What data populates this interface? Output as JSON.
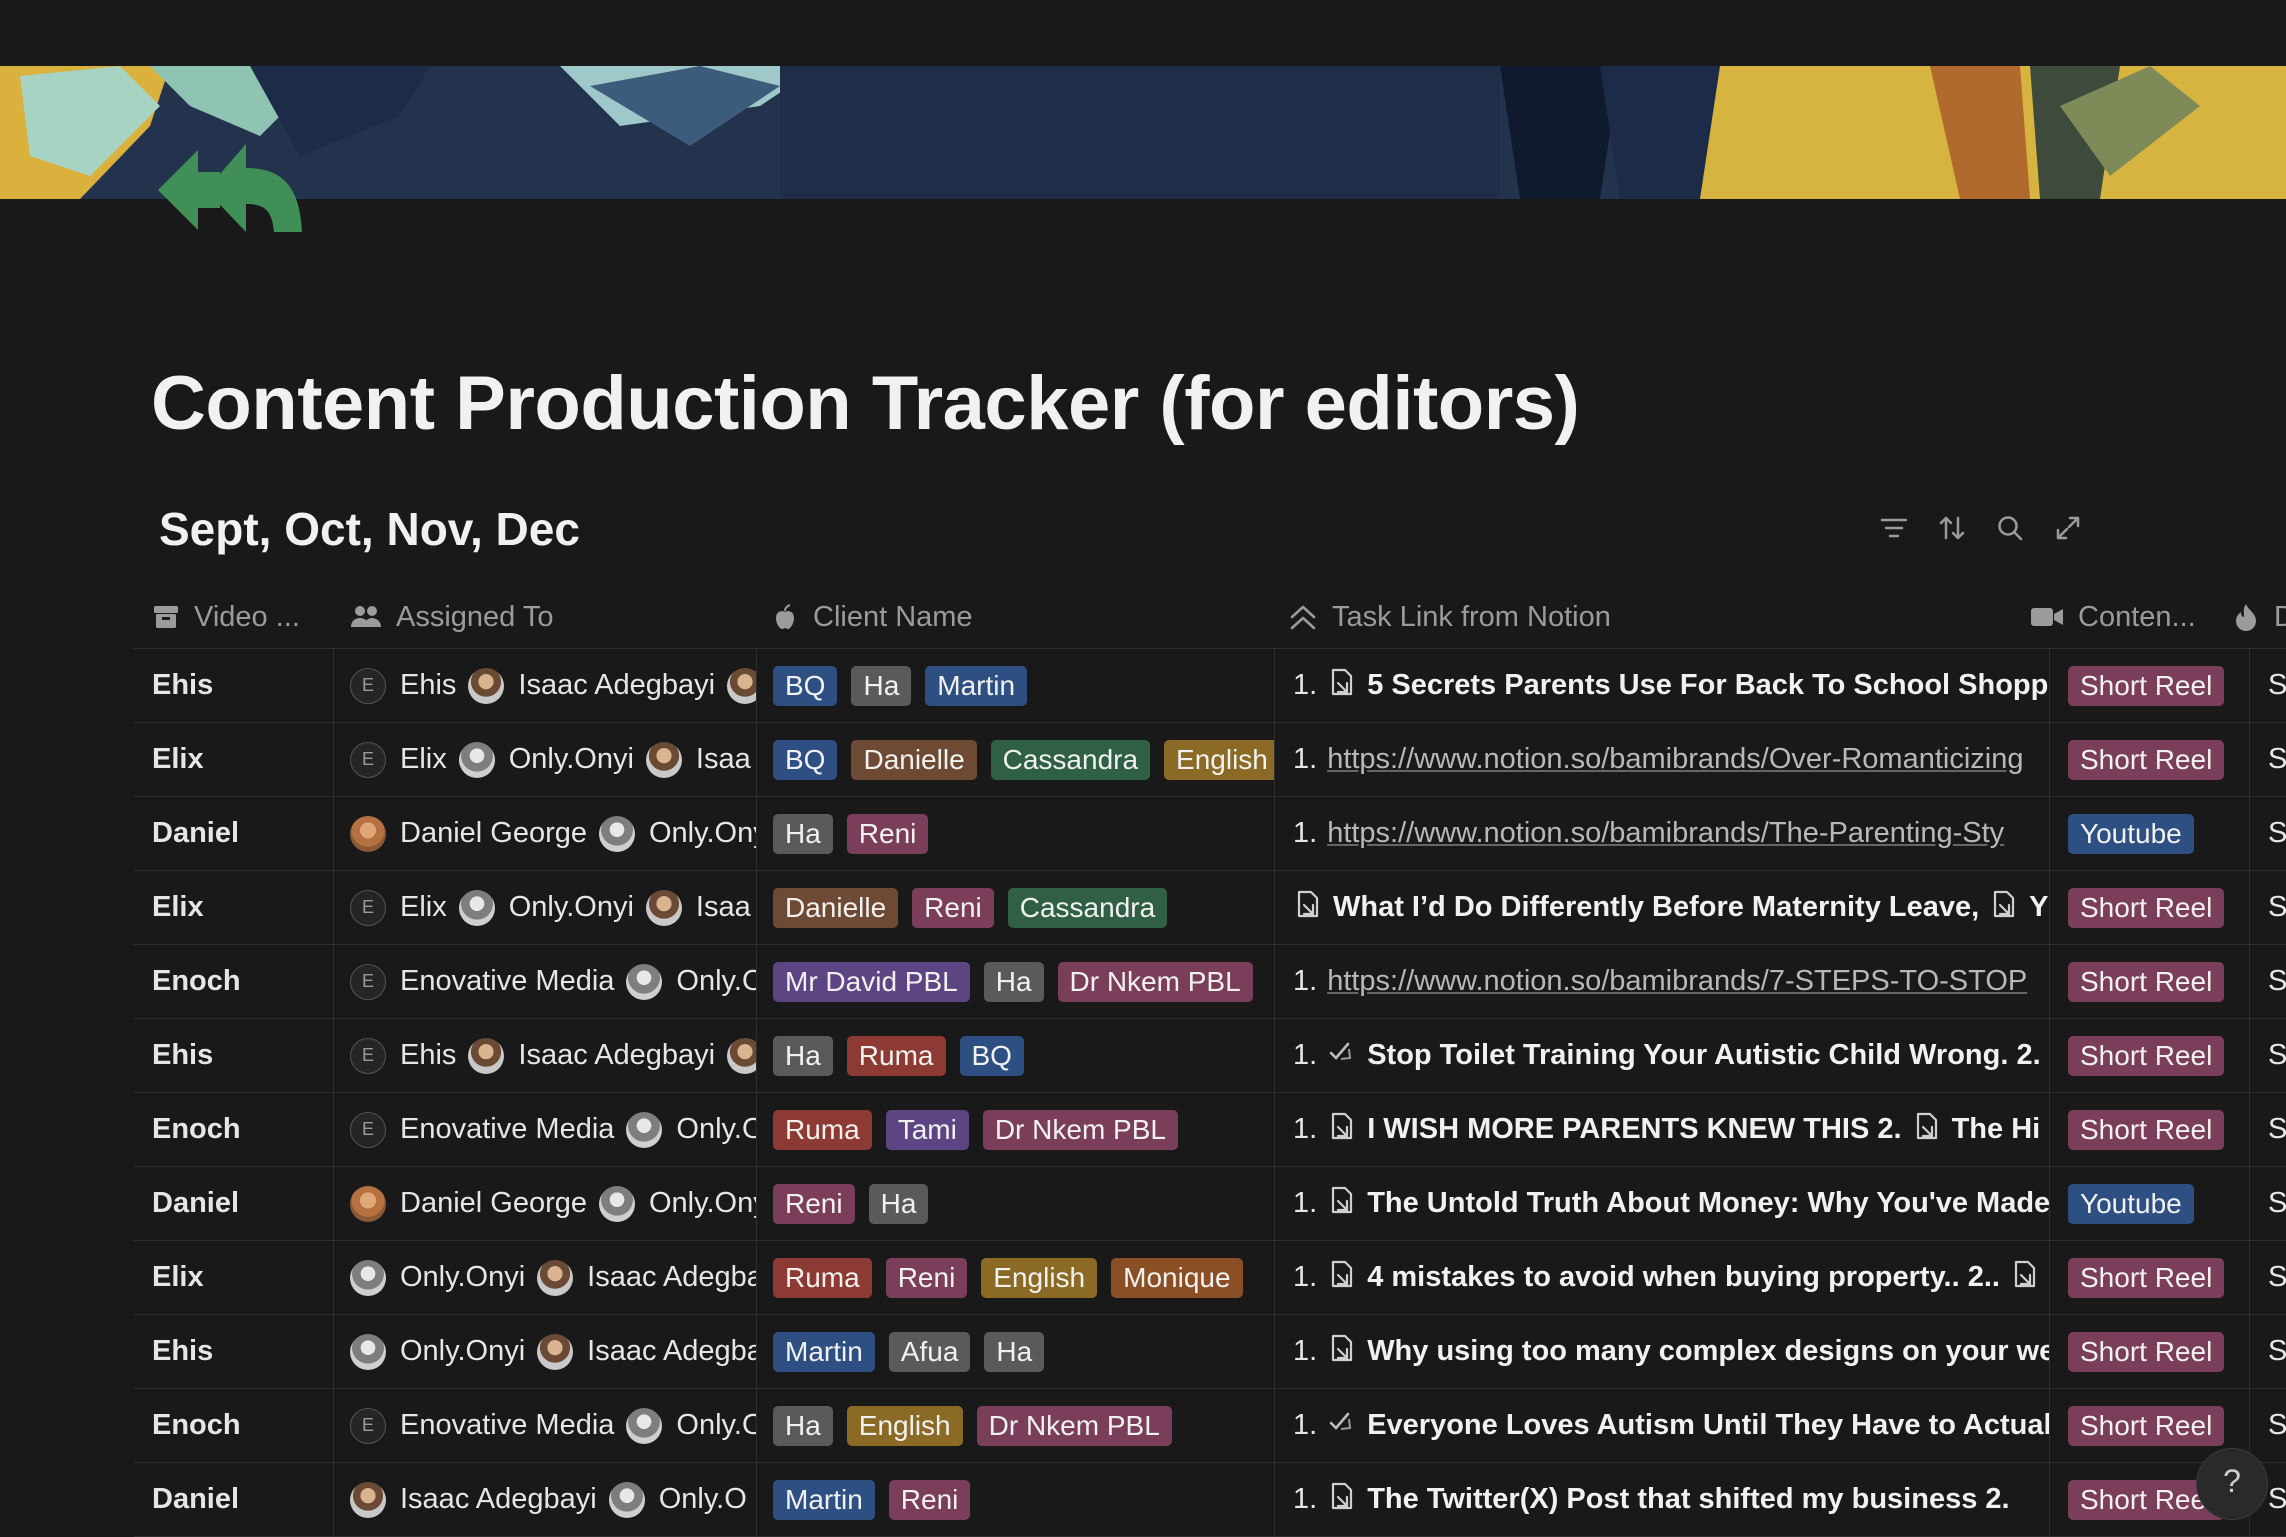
{
  "page": {
    "title": "Content Production Tracker (for editors)",
    "view_title": "Sept, Oct, Nov, Dec",
    "help_label": "?"
  },
  "icons": {
    "page_icon": "reply-all-arrows-icon",
    "filter": "filter-icon",
    "sort": "sort-icon",
    "search": "search-icon",
    "expand": "expand-icon"
  },
  "colors": {
    "background": "#191919",
    "page_icon": "#3f8f57"
  },
  "columns": {
    "video": "Video ...",
    "assigned": "Assigned To",
    "client": "Client Name",
    "task": "Task Link from Notion",
    "content": "Conten...",
    "date": "D"
  },
  "rows": [
    {
      "video": "Ehis",
      "assigned": [
        {
          "name": "Ehis",
          "avatar": "E"
        },
        {
          "name": "Isaac Adegbayi",
          "avatar": "photo"
        },
        {
          "name": "",
          "avatar": "photo"
        }
      ],
      "clients": [
        {
          "label": "BQ",
          "color": "blue"
        },
        {
          "label": "Ha",
          "color": "gray"
        },
        {
          "label": "Martin",
          "color": "blue"
        }
      ],
      "task": {
        "prefix": "1.",
        "text": "5 Secrets Parents Use For Back To School Shopp",
        "kind": "doc"
      },
      "content": "Short Reel",
      "content_color": "pink",
      "date": "Sept"
    },
    {
      "video": "Elix",
      "assigned": [
        {
          "name": "Elix",
          "avatar": "E"
        },
        {
          "name": "Only.Onyi",
          "avatar": "photo2"
        },
        {
          "name": "Isaa",
          "avatar": "photo"
        }
      ],
      "clients": [
        {
          "label": "BQ",
          "color": "blue"
        },
        {
          "label": "Danielle",
          "color": "brown"
        },
        {
          "label": "Cassandra",
          "color": "green"
        },
        {
          "label": "English",
          "color": "yellow"
        }
      ],
      "task": {
        "prefix": "1.",
        "text": "https://www.notion.so/bamibrands/Over-Romanticizing",
        "kind": "link"
      },
      "content": "Short Reel",
      "content_color": "pink",
      "date": "Sept"
    },
    {
      "video": "Daniel",
      "assigned": [
        {
          "name": "Daniel George",
          "avatar": "photo3"
        },
        {
          "name": "Only.Onyi",
          "avatar": "photo2"
        }
      ],
      "clients": [
        {
          "label": "Ha",
          "color": "gray"
        },
        {
          "label": "Reni",
          "color": "pink"
        }
      ],
      "task": {
        "prefix": "1.",
        "text": "https://www.notion.so/bamibrands/The-Parenting-Sty",
        "kind": "link"
      },
      "content": "Youtube",
      "content_color": "blue",
      "date": "Sept"
    },
    {
      "video": "Elix",
      "assigned": [
        {
          "name": "Elix",
          "avatar": "E"
        },
        {
          "name": "Only.Onyi",
          "avatar": "photo2"
        },
        {
          "name": "Isaa",
          "avatar": "photo"
        }
      ],
      "clients": [
        {
          "label": "Danielle",
          "color": "brown"
        },
        {
          "label": "Reni",
          "color": "pink"
        },
        {
          "label": "Cassandra",
          "color": "green"
        }
      ],
      "task": {
        "prefix": "",
        "text": "What I’d Do Differently Before Maternity Leave,",
        "kind": "doc",
        "trail": "Y"
      },
      "content": "Short Reel",
      "content_color": "pink",
      "date": "Sept"
    },
    {
      "video": "Enoch",
      "assigned": [
        {
          "name": "Enovative Media",
          "avatar": "E"
        },
        {
          "name": "Only.O",
          "avatar": "photo2"
        }
      ],
      "clients": [
        {
          "label": "Mr David PBL",
          "color": "purple"
        },
        {
          "label": "Ha",
          "color": "gray"
        },
        {
          "label": "Dr Nkem PBL",
          "color": "pink"
        }
      ],
      "task": {
        "prefix": "1.",
        "text": "https://www.notion.so/bamibrands/7-STEPS-TO-STOP",
        "kind": "link"
      },
      "content": "Short Reel",
      "content_color": "pink",
      "date": "Sept"
    },
    {
      "video": "Ehis",
      "assigned": [
        {
          "name": "Ehis",
          "avatar": "E"
        },
        {
          "name": "Isaac Adegbayi",
          "avatar": "photo"
        },
        {
          "name": "",
          "avatar": "photo"
        }
      ],
      "clients": [
        {
          "label": "Ha",
          "color": "gray"
        },
        {
          "label": "Ruma",
          "color": "red"
        },
        {
          "label": "BQ",
          "color": "blue"
        }
      ],
      "task": {
        "prefix": "1.",
        "text": "Stop Toilet Training Your Autistic Child Wrong. 2.",
        "kind": "check"
      },
      "content": "Short Reel",
      "content_color": "pink",
      "date": "Sept"
    },
    {
      "video": "Enoch",
      "assigned": [
        {
          "name": "Enovative Media",
          "avatar": "E"
        },
        {
          "name": "Only.O",
          "avatar": "photo2"
        }
      ],
      "clients": [
        {
          "label": "Ruma",
          "color": "red"
        },
        {
          "label": "Tami",
          "color": "purple"
        },
        {
          "label": "Dr Nkem PBL",
          "color": "pink"
        }
      ],
      "task": {
        "prefix": "1.",
        "text": "I WISH MORE PARENTS KNEW THIS 2.",
        "kind": "doc",
        "trail": "The Hi"
      },
      "content": "Short Reel",
      "content_color": "pink",
      "date": "Sept"
    },
    {
      "video": "Daniel",
      "assigned": [
        {
          "name": "Daniel George",
          "avatar": "photo3"
        },
        {
          "name": "Only.Onyi",
          "avatar": "photo2"
        }
      ],
      "clients": [
        {
          "label": "Reni",
          "color": "pink"
        },
        {
          "label": "Ha",
          "color": "gray"
        }
      ],
      "task": {
        "prefix": "1.",
        "text": "The Untold Truth About Money: Why You've Made",
        "kind": "doc"
      },
      "content": "Youtube",
      "content_color": "blue",
      "date": "Sept"
    },
    {
      "video": "Elix",
      "assigned": [
        {
          "name": "Only.Onyi",
          "avatar": "photo2"
        },
        {
          "name": "Isaac Adegba",
          "avatar": "photo"
        }
      ],
      "clients": [
        {
          "label": "Ruma",
          "color": "red"
        },
        {
          "label": "Reni",
          "color": "pink"
        },
        {
          "label": "English",
          "color": "yellow"
        },
        {
          "label": "Monique",
          "color": "orange"
        }
      ],
      "task": {
        "prefix": "1.",
        "text": "4 mistakes to avoid when buying property.. 2..",
        "kind": "doc",
        "trail": ""
      },
      "content": "Short Reel",
      "content_color": "pink",
      "date": "Sept"
    },
    {
      "video": "Ehis",
      "assigned": [
        {
          "name": "Only.Onyi",
          "avatar": "photo2"
        },
        {
          "name": "Isaac Adegba",
          "avatar": "photo"
        }
      ],
      "clients": [
        {
          "label": "Martin",
          "color": "blue"
        },
        {
          "label": "Afua",
          "color": "gray-dark"
        },
        {
          "label": "Ha",
          "color": "gray"
        }
      ],
      "task": {
        "prefix": "1.",
        "text": "Why using too many complex designs on your we",
        "kind": "doc"
      },
      "content": "Short Reel",
      "content_color": "pink",
      "date": "Sept"
    },
    {
      "video": "Enoch",
      "assigned": [
        {
          "name": "Enovative Media",
          "avatar": "E"
        },
        {
          "name": "Only.O",
          "avatar": "photo2"
        }
      ],
      "clients": [
        {
          "label": "Ha",
          "color": "gray"
        },
        {
          "label": "English",
          "color": "yellow"
        },
        {
          "label": "Dr Nkem PBL",
          "color": "pink"
        }
      ],
      "task": {
        "prefix": "1.",
        "text": "Everyone Loves Autism Until They Have to Actual",
        "kind": "check"
      },
      "content": "Short Reel",
      "content_color": "pink",
      "date": "Sept"
    },
    {
      "video": "Daniel",
      "assigned": [
        {
          "name": "Isaac Adegbayi",
          "avatar": "photo"
        },
        {
          "name": "Only.O",
          "avatar": "photo2"
        }
      ],
      "clients": [
        {
          "label": "Martin",
          "color": "blue"
        },
        {
          "label": "Reni",
          "color": "pink"
        }
      ],
      "task": {
        "prefix": "1.",
        "text": "The Twitter(X) Post that shifted my business 2.",
        "kind": "doc"
      },
      "content": "Short Reel",
      "content_color": "pink",
      "date": "Sept"
    }
  ]
}
